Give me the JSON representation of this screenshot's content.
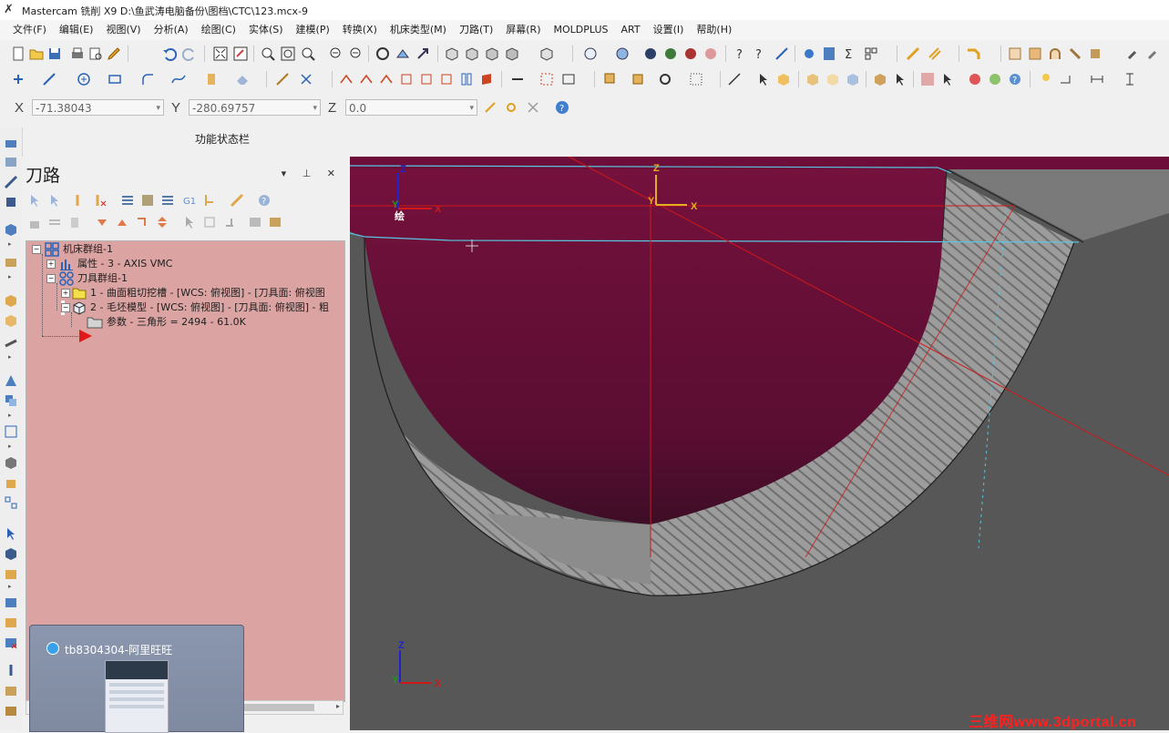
{
  "title": {
    "app_icon": "mastercam-x-logo",
    "text": "Mastercam 铣削 X9  D:\\鱼武涛电脑备份\\图档\\CTC\\123.mcx-9"
  },
  "menu": [
    "文件(F)",
    "编辑(E)",
    "视图(V)",
    "分析(A)",
    "绘图(C)",
    "实体(S)",
    "建模(P)",
    "转换(X)",
    "机床类型(M)",
    "刀路(T)",
    "屏幕(R)",
    "MOLDPLUS",
    "ART",
    "设置(I)",
    "帮助(H)"
  ],
  "coords": {
    "x_label": "X",
    "x_value": "-71.38043",
    "y_label": "Y",
    "y_value": "-280.69757",
    "z_label": "Z",
    "z_value": "0.0"
  },
  "status_bar_label": "功能状态栏",
  "panel": {
    "title": "刀路",
    "controls": "▾ ⊥ ✕",
    "tree": {
      "machine_group": "机床群组-1",
      "properties": "属性 - 3 - AXIS VMC",
      "toolpath_group": "刀具群组-1",
      "op1": "1 - 曲面粗切挖槽 - [WCS: 俯视图] - [刀具面: 俯视图",
      "op2": "2 - 毛坯模型 - [WCS: 俯视图] - [刀具面: 俯视图] - 粗",
      "params": "参数 - 三角形 =  2494 - 61.0K"
    }
  },
  "popup": {
    "text": "tb8304304-阿里旺旺"
  },
  "viewport": {
    "axis_top_left": {
      "z": "Z",
      "x": "X",
      "y": "Y"
    },
    "axis_center": {
      "z": "Z",
      "x": "X",
      "y": "Y"
    },
    "axis_bottom": {
      "z": "Z",
      "x": "X",
      "y": "Y"
    },
    "label_hui": "绘",
    "colors": {
      "pocket": "#6e1038",
      "stock": "#575757",
      "steps": "#a3a3a3",
      "axis_red": "#d01818",
      "cyan": "#58c6e0"
    }
  },
  "watermark": "三维网www.3dportal.cn"
}
